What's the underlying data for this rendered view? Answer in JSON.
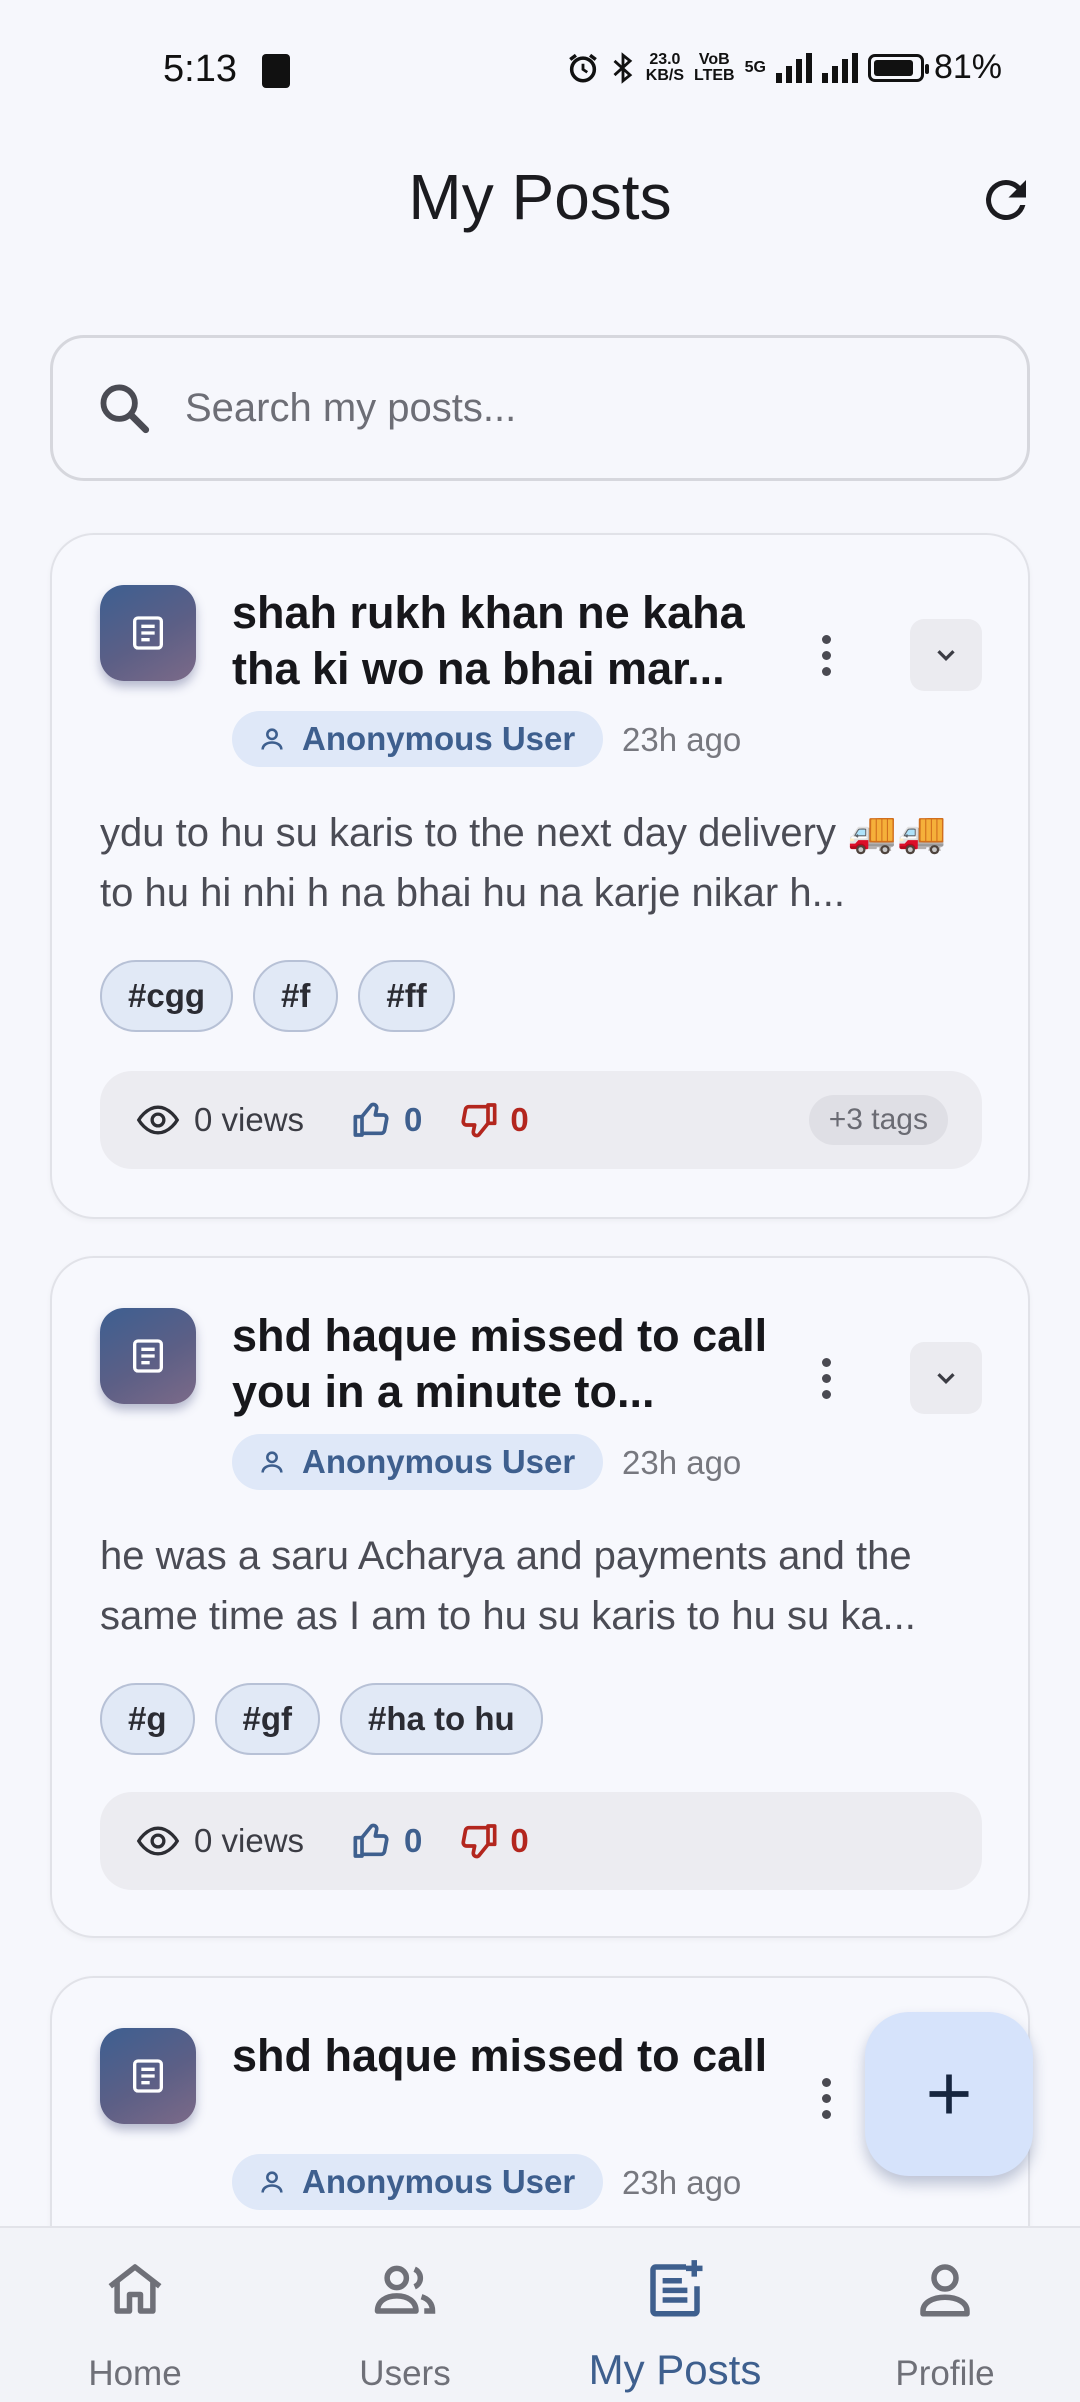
{
  "status_bar": {
    "time": "5:13",
    "net_speed_top": "23.0",
    "net_speed_bottom": "KB/S",
    "volte_top": "VoB",
    "volte_bottom": "LTEB",
    "net_type": "5G",
    "battery": "81%"
  },
  "app_bar": {
    "title": "My Posts"
  },
  "search": {
    "placeholder": "Search my posts...",
    "value": ""
  },
  "posts": [
    {
      "title": "shah rukh khan ne kaha tha ki wo na bhai mar...",
      "author": "Anonymous User",
      "time": "23h ago",
      "body": "ydu to hu su karis to the next day delivery 🚚🚚 to hu hi nhi h na bhai hu na karje nikar h...",
      "tags": [
        "#cgg",
        "#f",
        "#ff"
      ],
      "views": "0 views",
      "likes": "0",
      "dislikes": "0",
      "more_tags": "+3 tags"
    },
    {
      "title": "shd haque missed to call you in a minute to...",
      "author": "Anonymous User",
      "time": "23h ago",
      "body": "he was a saru Acharya and payments and the same time as I am to hu su karis to hu su ka...",
      "tags": [
        "#g",
        "#gf",
        "#ha to hu"
      ],
      "views": "0 views",
      "likes": "0",
      "dislikes": "0"
    },
    {
      "title": "shd haque missed to call",
      "author": "Anonymous User",
      "time": "23h ago"
    }
  ],
  "bottom_nav": {
    "items": [
      {
        "label": "Home",
        "icon": "home-icon"
      },
      {
        "label": "Users",
        "icon": "users-icon"
      },
      {
        "label": "My Posts",
        "icon": "post-add-icon",
        "active": true
      },
      {
        "label": "Profile",
        "icon": "person-icon"
      }
    ]
  },
  "colors": {
    "background": "#f6f7fc",
    "primary": "#3e5f8e",
    "dislike": "#b3261e",
    "fab": "#d6e3fb",
    "chip": "#dfe8f8"
  }
}
